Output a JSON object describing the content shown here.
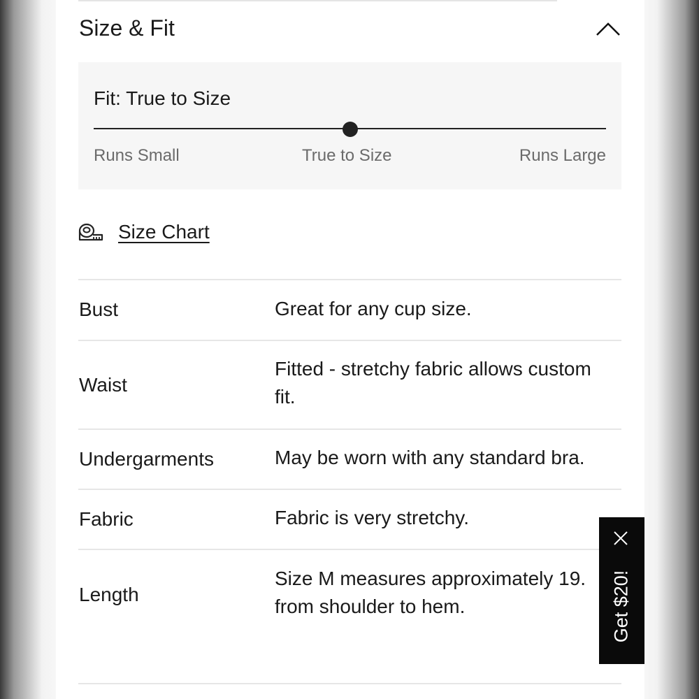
{
  "section": {
    "title": "Size & Fit"
  },
  "fit": {
    "heading": "Fit: True to Size",
    "scale_labels": [
      "Runs Small",
      "True to Size",
      "Runs Large"
    ],
    "position": 0.5
  },
  "size_chart": {
    "label": "Size Chart"
  },
  "rows": [
    {
      "label": "Bust",
      "value_lines": [
        "Great for any cup size."
      ]
    },
    {
      "label": "Waist",
      "value_lines": [
        "Fitted - stretchy fabric allows custom",
        "fit."
      ]
    },
    {
      "label": "Undergarments",
      "value_lines": [
        "May be worn with any standard bra."
      ]
    },
    {
      "label": "Fabric",
      "value_lines": [
        "Fabric is very stretchy."
      ]
    },
    {
      "label": "Length",
      "value_lines": [
        "Size M measures approximately 19.",
        "from shoulder to hem."
      ]
    }
  ],
  "promo": {
    "label": "Get $20!",
    "close_icon": "close-icon",
    "background": "#0a0a0a"
  },
  "icons": {
    "collapse": "chevron-up-icon",
    "size_chart": "measuring-tape-icon"
  }
}
